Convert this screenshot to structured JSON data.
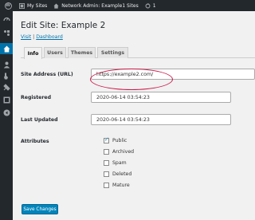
{
  "admin_bar": {
    "my_sites": "My Sites",
    "network_admin": "Network Admin: Example1 Sites",
    "update_count": "1"
  },
  "page": {
    "title": "Edit Site: Example 2",
    "visit_link": "Visit",
    "separator": "|",
    "dashboard_link": "Dashboard"
  },
  "tabs": [
    "Info",
    "Users",
    "Themes",
    "Settings"
  ],
  "fields": {
    "site_address": {
      "label": "Site Address (URL)",
      "value": "https://example2.com/"
    },
    "registered": {
      "label": "Registered",
      "value": "2020-06-14 03:54:23"
    },
    "last_updated": {
      "label": "Last Updated",
      "value": "2020-06-14 03:54:23"
    }
  },
  "attributes": {
    "label": "Attributes",
    "options": [
      {
        "label": "Public",
        "checked": true
      },
      {
        "label": "Archived",
        "checked": false
      },
      {
        "label": "Spam",
        "checked": false
      },
      {
        "label": "Deleted",
        "checked": false
      },
      {
        "label": "Mature",
        "checked": false
      }
    ]
  },
  "save_button": "Save Changes",
  "colors": {
    "admin_bar": "#23282d",
    "accent": "#0073aa",
    "button": "#0085ba",
    "annotation": "#cc1b4a"
  }
}
